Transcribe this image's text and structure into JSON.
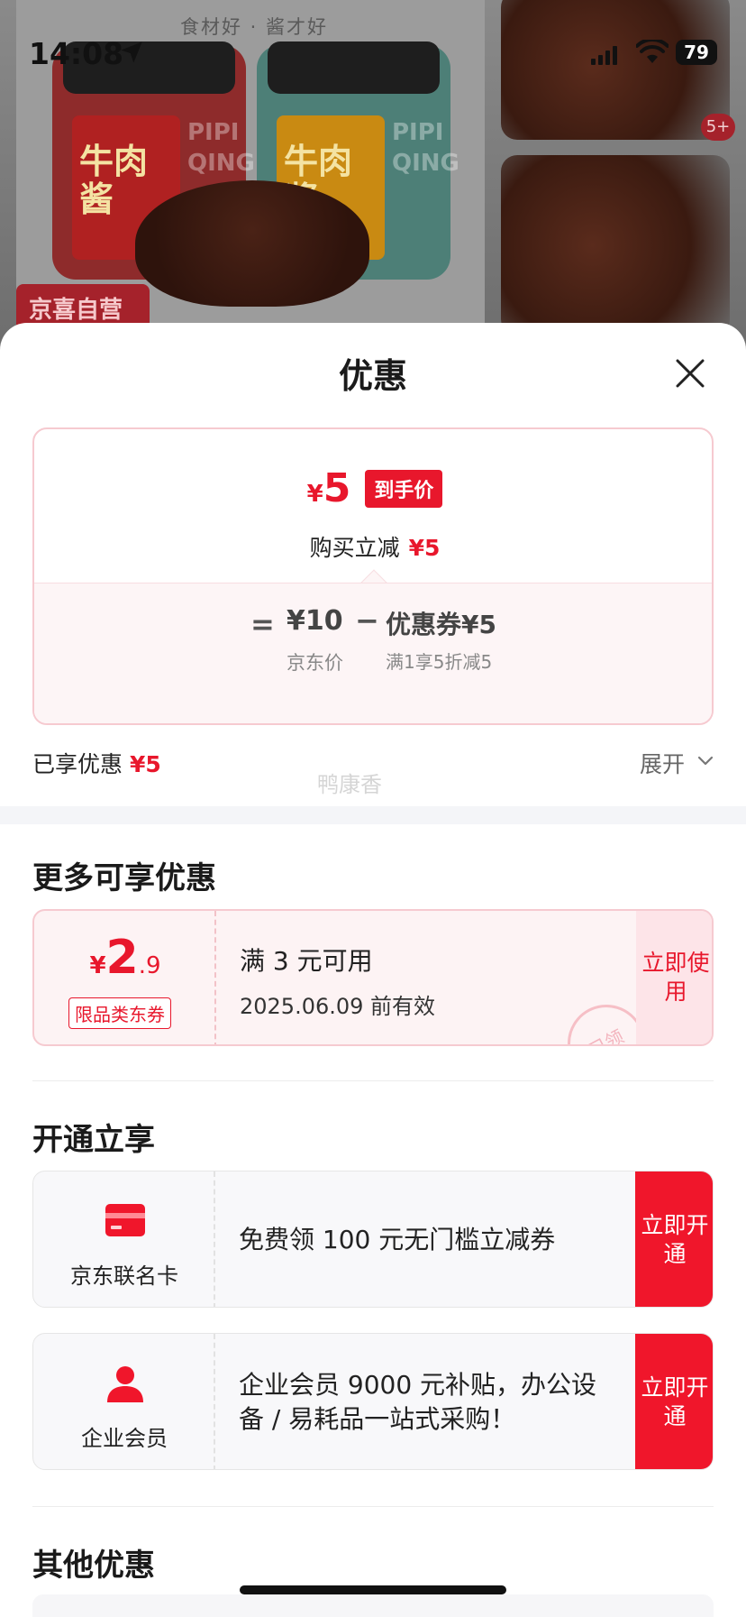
{
  "background": {
    "tagline": "食材好 · 酱才好",
    "jar_label": "牛肉酱",
    "jar_pinyin": "PIPI QING",
    "badge": "京喜自营",
    "thumb_count": "5+"
  },
  "status_bar": {
    "time": "14:08",
    "battery": "79"
  },
  "sheet": {
    "title": "优惠",
    "price": {
      "yen": "¥",
      "value": "5",
      "pill": "到手价",
      "instant_label": "购买立减",
      "instant_amount": "¥5",
      "eq": "=",
      "jd_price": "¥10",
      "jd_label": "京东价",
      "minus": "−",
      "coupon_amount": "优惠券¥5",
      "coupon_desc": "满1享5折减5"
    },
    "enjoyed_label": "已享优惠",
    "enjoyed_amount": "¥5",
    "expand_label": "展开",
    "faded_text": "鸭康香",
    "more_title": "更多可享优惠",
    "coupon": {
      "yen": "¥",
      "int": "2",
      "dec": ".9",
      "type": "限品类东券",
      "condition": "满 3 元可用",
      "expiry": "2025.06.09 前有效",
      "action": "立即使用",
      "stamp": "已领"
    },
    "open_title": "开通立享",
    "offers": [
      {
        "icon": "credit-card-icon",
        "name": "京东联名卡",
        "text": "免费领 100 元无门槛立减券",
        "action": "立即开通"
      },
      {
        "icon": "user-icon",
        "name": "企业会员",
        "text": "企业会员 9000 元补贴，办公设备 / 易耗品一站式采购！",
        "action": "立即开通"
      }
    ],
    "other_title": "其他优惠"
  },
  "colors": {
    "accent": "#e8172c",
    "action_bg": "#f0162b",
    "coupon_bg": "#fdf3f4"
  }
}
